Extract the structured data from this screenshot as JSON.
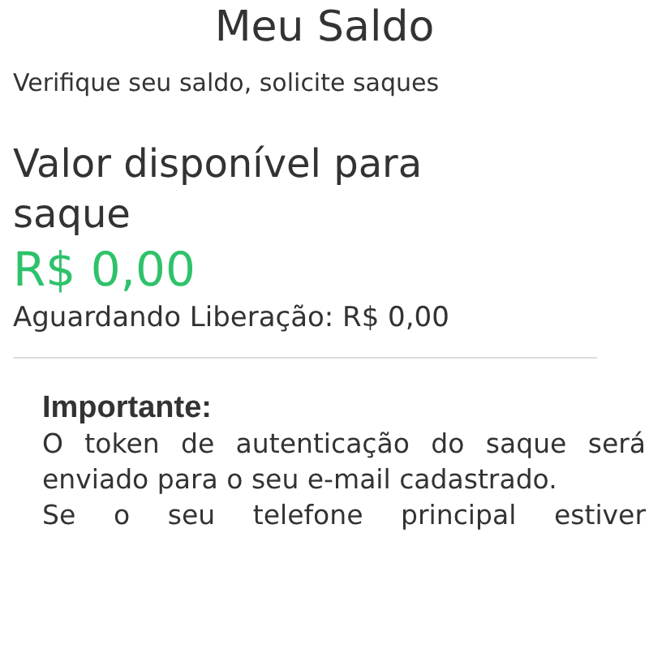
{
  "title": "Meu Saldo",
  "subtitle": "Verifique seu saldo, solicite saques",
  "balance": {
    "label": "Valor disponível para saque",
    "value": "R$ 0,00",
    "pending": "Aguardando Liberação: R$ 0,00"
  },
  "notice": {
    "heading": "Importante:",
    "paragraphs": [
      "O token de autenticação do saque será enviado para o seu e-mail cadastrado.",
      "Se o seu telefone principal estiver"
    ]
  }
}
